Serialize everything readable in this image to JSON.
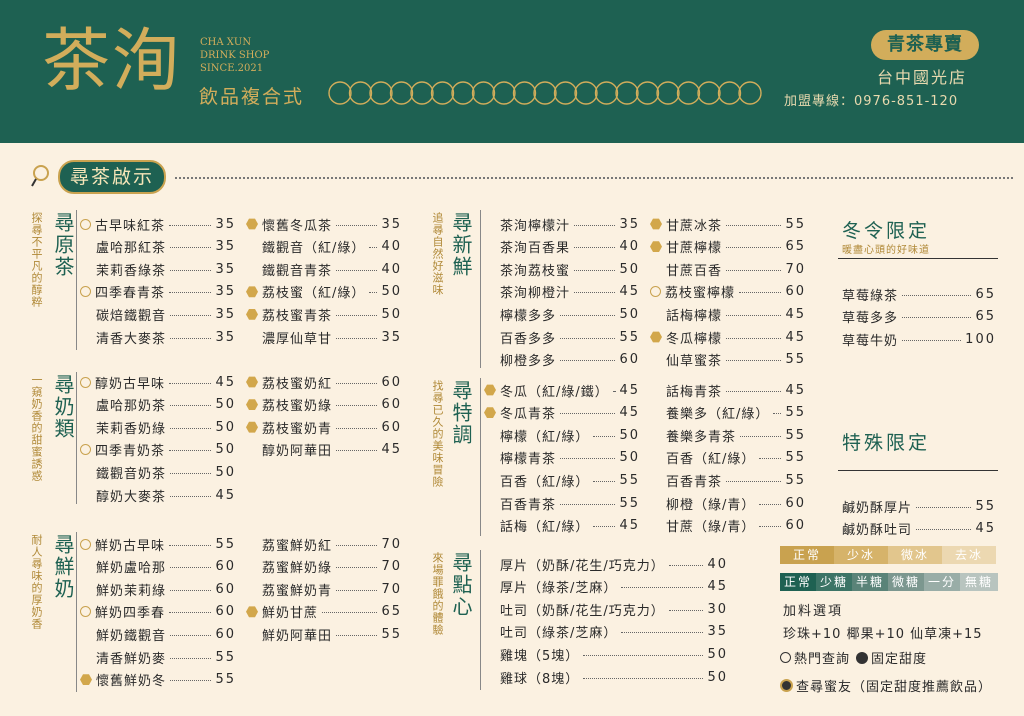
{
  "header": {
    "logo": "茶洵",
    "english_lines": [
      "CHA XUN",
      "DRINK SHOP",
      "SINCE.2021"
    ],
    "subtitle": "飲品複合式",
    "badge": "青茶專賣",
    "branch": "台中國光店",
    "phone": "加盟專線：0976-851-120",
    "colors": {
      "bg": "#1e6152",
      "gold": "#d2ad5b"
    }
  },
  "section": {
    "title": "尋茶啟示",
    "icon": "search-icon"
  },
  "categories": [
    {
      "title": "尋原茶",
      "subtitle": "探尋不平凡的醇粹",
      "items": [
        {
          "name": "古早味紅茶",
          "price": "35",
          "icon": "search"
        },
        {
          "name": "盧哈那紅茶",
          "price": "35",
          "icon": ""
        },
        {
          "name": "茉莉香綠茶",
          "price": "35",
          "icon": ""
        },
        {
          "name": "四季春青茶",
          "price": "35",
          "icon": "search"
        },
        {
          "name": "碳焙鐵觀音",
          "price": "35",
          "icon": ""
        },
        {
          "name": "清香大麥茶",
          "price": "35",
          "icon": ""
        },
        {
          "name": "懷舊冬瓜茶",
          "price": "35",
          "icon": "hex"
        },
        {
          "name": "鐵觀音（紅/綠）",
          "price": "40",
          "icon": ""
        },
        {
          "name": "鐵觀音青茶",
          "price": "40",
          "icon": ""
        },
        {
          "name": "荔枝蜜（紅/綠）",
          "price": "50",
          "icon": "hex"
        },
        {
          "name": "荔枝蜜青茶",
          "price": "50",
          "icon": "hex"
        },
        {
          "name": "濃厚仙草甘",
          "price": "35",
          "icon": ""
        }
      ]
    },
    {
      "title": "尋奶類",
      "subtitle": "一窺奶香的甜蜜誘惑",
      "items": [
        {
          "name": "醇奶古早味",
          "price": "45",
          "icon": "search"
        },
        {
          "name": "盧哈那奶茶",
          "price": "50",
          "icon": ""
        },
        {
          "name": "茉莉香奶綠",
          "price": "50",
          "icon": ""
        },
        {
          "name": "四季青奶茶",
          "price": "50",
          "icon": "search"
        },
        {
          "name": "鐵觀音奶茶",
          "price": "50",
          "icon": ""
        },
        {
          "name": "醇奶大麥茶",
          "price": "45",
          "icon": ""
        },
        {
          "name": "荔枝蜜奶紅",
          "price": "60",
          "icon": "hex"
        },
        {
          "name": "荔枝蜜奶綠",
          "price": "60",
          "icon": "hex"
        },
        {
          "name": "荔枝蜜奶青",
          "price": "60",
          "icon": "hex"
        },
        {
          "name": "醇奶阿華田",
          "price": "45",
          "icon": ""
        }
      ]
    },
    {
      "title": "尋鮮奶",
      "subtitle": "耐人尋味的厚奶香",
      "items": [
        {
          "name": "鮮奶古早味",
          "price": "55",
          "icon": "search"
        },
        {
          "name": "鮮奶盧哈那",
          "price": "60",
          "icon": ""
        },
        {
          "name": "鮮奶茉莉綠",
          "price": "60",
          "icon": ""
        },
        {
          "name": "鮮奶四季春",
          "price": "60",
          "icon": "search"
        },
        {
          "name": "鮮奶鐵觀音",
          "price": "60",
          "icon": ""
        },
        {
          "name": "清香鮮奶麥",
          "price": "55",
          "icon": ""
        },
        {
          "name": "懷舊鮮奶冬",
          "price": "55",
          "icon": "hex"
        },
        {
          "name": "荔蜜鮮奶紅",
          "price": "70",
          "icon": ""
        },
        {
          "name": "荔蜜鮮奶綠",
          "price": "70",
          "icon": ""
        },
        {
          "name": "荔蜜鮮奶青",
          "price": "70",
          "icon": ""
        },
        {
          "name": "鮮奶甘蔗",
          "price": "65",
          "icon": "hex"
        },
        {
          "name": "鮮奶阿華田",
          "price": "55",
          "icon": ""
        }
      ]
    },
    {
      "title": "尋新鮮",
      "subtitle": "追尋自然好滋味",
      "items": [
        {
          "name": "茶洵檸檬汁",
          "price": "35",
          "icon": ""
        },
        {
          "name": "茶洵百香果",
          "price": "40",
          "icon": ""
        },
        {
          "name": "茶洵荔枝蜜",
          "price": "50",
          "icon": ""
        },
        {
          "name": "茶洵柳橙汁",
          "price": "45",
          "icon": ""
        },
        {
          "name": "檸檬多多",
          "price": "50",
          "icon": ""
        },
        {
          "name": "百香多多",
          "price": "55",
          "icon": ""
        },
        {
          "name": "柳橙多多",
          "price": "60",
          "icon": ""
        },
        {
          "name": "甘蔗冰茶",
          "price": "55",
          "icon": "hex"
        },
        {
          "name": "甘蔗檸檬",
          "price": "65",
          "icon": "hex"
        },
        {
          "name": "甘蔗百香",
          "price": "70",
          "icon": ""
        },
        {
          "name": "荔枝蜜檸檬",
          "price": "60",
          "icon": "search"
        },
        {
          "name": "話梅檸檬",
          "price": "45",
          "icon": ""
        },
        {
          "name": "冬瓜檸檬",
          "price": "45",
          "icon": "hex"
        },
        {
          "name": "仙草蜜茶",
          "price": "55",
          "icon": ""
        }
      ]
    },
    {
      "title": "尋特調",
      "subtitle": "找尋已久的美味冒險",
      "items": [
        {
          "name": "冬瓜（紅/綠/鐵）",
          "price": "45",
          "icon": "hex"
        },
        {
          "name": "冬瓜青茶",
          "price": "45",
          "icon": "hex"
        },
        {
          "name": "檸檬（紅/綠）",
          "price": "50",
          "icon": ""
        },
        {
          "name": "檸檬青茶",
          "price": "50",
          "icon": ""
        },
        {
          "name": "百香（紅/綠）",
          "price": "55",
          "icon": ""
        },
        {
          "name": "百香青茶",
          "price": "55",
          "icon": ""
        },
        {
          "name": "話梅（紅/綠）",
          "price": "45",
          "icon": ""
        },
        {
          "name": "話梅青茶",
          "price": "45",
          "icon": ""
        },
        {
          "name": "養樂多（紅/綠）",
          "price": "55",
          "icon": ""
        },
        {
          "name": "養樂多青茶",
          "price": "55",
          "icon": ""
        },
        {
          "name": "百香（紅/綠）",
          "price": "55",
          "icon": ""
        },
        {
          "name": "百香青茶",
          "price": "55",
          "icon": ""
        },
        {
          "name": "柳橙（綠/青）",
          "price": "60",
          "icon": ""
        },
        {
          "name": "甘蔗（綠/青）",
          "price": "60",
          "icon": ""
        }
      ]
    },
    {
      "title": "尋點心",
      "subtitle": "來場罪餓的體驗",
      "items": [
        {
          "name": "厚片（奶酥/花生/巧克力）",
          "price": "40",
          "icon": ""
        },
        {
          "name": "厚片（綠茶/芝麻）",
          "price": "45",
          "icon": ""
        },
        {
          "name": "吐司（奶酥/花生/巧克力）",
          "price": "30",
          "icon": ""
        },
        {
          "name": "吐司（綠茶/芝麻）",
          "price": "35",
          "icon": ""
        },
        {
          "name": "雞塊（5塊）",
          "price": "50",
          "icon": ""
        },
        {
          "name": "雞球（8塊）",
          "price": "50",
          "icon": ""
        }
      ]
    }
  ],
  "winter": {
    "title": "冬令限定",
    "subtitle": "暖盡心頭的好味道",
    "items": [
      {
        "name": "草莓綠茶",
        "price": "65"
      },
      {
        "name": "草莓多多",
        "price": "65"
      },
      {
        "name": "草莓牛奶",
        "price": "100"
      }
    ]
  },
  "special": {
    "title": "特殊限定",
    "items": [
      {
        "name": "鹹奶酥厚片",
        "price": "55"
      },
      {
        "name": "鹹奶酥吐司",
        "price": "45"
      }
    ]
  },
  "ice_levels": [
    "正常",
    "少冰",
    "微冰",
    "去冰"
  ],
  "sugar_levels": [
    "正常",
    "少糖",
    "半糖",
    "微糖",
    "一分",
    "無糖"
  ],
  "addons": {
    "title": "加料選項",
    "items": "珍珠+10 椰果+10 仙草凍+15"
  },
  "legend": {
    "popular": "熱門查詢",
    "fixed": "固定甜度",
    "recommend": "查尋蜜友（固定甜度推薦飲品）"
  }
}
